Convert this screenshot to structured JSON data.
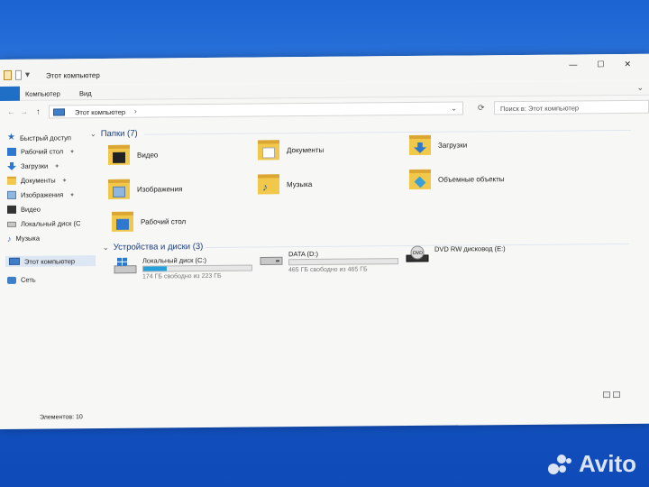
{
  "window": {
    "title": "Этот компьютер",
    "controls": [
      "—",
      "☐",
      "✕"
    ]
  },
  "ribbon": {
    "file_tab": "",
    "tabs": [
      "Компьютер",
      "Вид"
    ]
  },
  "address": {
    "crumb": "Этот компьютер",
    "search_placeholder": "Поиск в: Этот компьютер"
  },
  "sidebar": {
    "items": [
      {
        "label": "Быстрый доступ",
        "icon": "star-icon",
        "pinned": false
      },
      {
        "label": "Рабочий стол",
        "icon": "desktop-icon",
        "pinned": true
      },
      {
        "label": "Загрузки",
        "icon": "downloads-icon",
        "pinned": true
      },
      {
        "label": "Документы",
        "icon": "documents-icon",
        "pinned": true
      },
      {
        "label": "Изображения",
        "icon": "pictures-icon",
        "pinned": true
      },
      {
        "label": "Видео",
        "icon": "video-icon",
        "pinned": false
      },
      {
        "label": "Локальный диск (C",
        "icon": "drive-icon",
        "pinned": false
      },
      {
        "label": "Музыка",
        "icon": "music-icon",
        "pinned": false
      },
      {
        "label": "Этот компьютер",
        "icon": "computer-icon",
        "pinned": false,
        "selected": true
      },
      {
        "label": "Сеть",
        "icon": "network-icon",
        "pinned": false
      }
    ]
  },
  "folders": {
    "header": "Папки (7)",
    "items": [
      {
        "label": "Видео",
        "icon": "video-folder-icon"
      },
      {
        "label": "Документы",
        "icon": "documents-folder-icon"
      },
      {
        "label": "Загрузки",
        "icon": "downloads-folder-icon"
      },
      {
        "label": "Изображения",
        "icon": "pictures-folder-icon"
      },
      {
        "label": "Музыка",
        "icon": "music-folder-icon"
      },
      {
        "label": "Объемные объекты",
        "icon": "3d-objects-folder-icon"
      },
      {
        "label": "Рабочий стол",
        "icon": "desktop-folder-icon"
      }
    ]
  },
  "drives": {
    "header": "Устройства и диски (3)",
    "items": [
      {
        "name": "Локальный диск (C:)",
        "free": "174 ГБ свободно из 223 ГБ",
        "used_fraction": 0.22,
        "icon": "windows-drive-icon"
      },
      {
        "name": "DATA (D:)",
        "free": "465 ГБ свободно из 465 ГБ",
        "used_fraction": 0.0,
        "icon": "hard-drive-icon"
      },
      {
        "name": "DVD RW дисковод (E:)",
        "free": "",
        "icon": "dvd-drive-icon"
      }
    ]
  },
  "status": {
    "items_count": "Элементов: 10"
  },
  "watermark": "Avito",
  "colors": {
    "accent": "#26a0da",
    "folder": "#f1c84a",
    "file_tab": "#1f6fc7"
  }
}
